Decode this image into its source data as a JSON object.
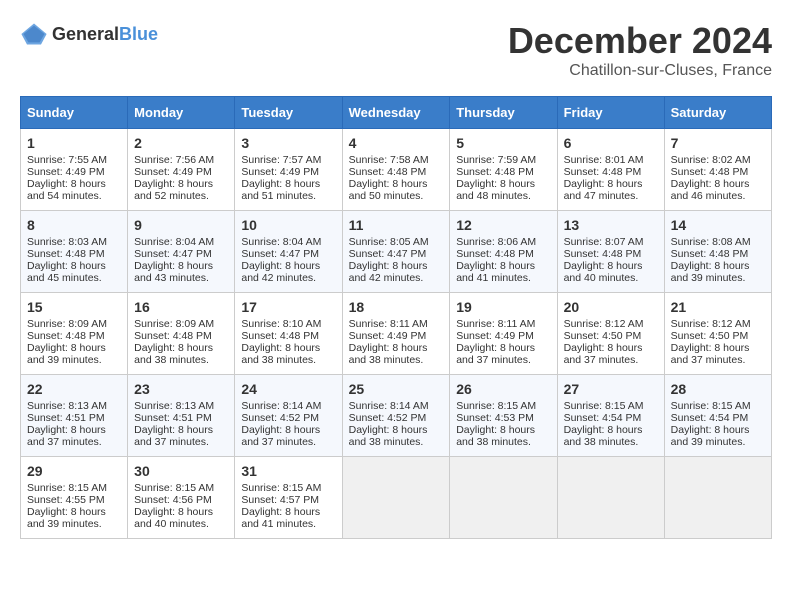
{
  "header": {
    "logo_general": "General",
    "logo_blue": "Blue",
    "title": "December 2024",
    "location": "Chatillon-sur-Cluses, France"
  },
  "calendar": {
    "days_of_week": [
      "Sunday",
      "Monday",
      "Tuesday",
      "Wednesday",
      "Thursday",
      "Friday",
      "Saturday"
    ],
    "weeks": [
      [
        {
          "day": "1",
          "sunrise": "Sunrise: 7:55 AM",
          "sunset": "Sunset: 4:49 PM",
          "daylight": "Daylight: 8 hours and 54 minutes."
        },
        {
          "day": "2",
          "sunrise": "Sunrise: 7:56 AM",
          "sunset": "Sunset: 4:49 PM",
          "daylight": "Daylight: 8 hours and 52 minutes."
        },
        {
          "day": "3",
          "sunrise": "Sunrise: 7:57 AM",
          "sunset": "Sunset: 4:49 PM",
          "daylight": "Daylight: 8 hours and 51 minutes."
        },
        {
          "day": "4",
          "sunrise": "Sunrise: 7:58 AM",
          "sunset": "Sunset: 4:48 PM",
          "daylight": "Daylight: 8 hours and 50 minutes."
        },
        {
          "day": "5",
          "sunrise": "Sunrise: 7:59 AM",
          "sunset": "Sunset: 4:48 PM",
          "daylight": "Daylight: 8 hours and 48 minutes."
        },
        {
          "day": "6",
          "sunrise": "Sunrise: 8:01 AM",
          "sunset": "Sunset: 4:48 PM",
          "daylight": "Daylight: 8 hours and 47 minutes."
        },
        {
          "day": "7",
          "sunrise": "Sunrise: 8:02 AM",
          "sunset": "Sunset: 4:48 PM",
          "daylight": "Daylight: 8 hours and 46 minutes."
        }
      ],
      [
        {
          "day": "8",
          "sunrise": "Sunrise: 8:03 AM",
          "sunset": "Sunset: 4:48 PM",
          "daylight": "Daylight: 8 hours and 45 minutes."
        },
        {
          "day": "9",
          "sunrise": "Sunrise: 8:04 AM",
          "sunset": "Sunset: 4:47 PM",
          "daylight": "Daylight: 8 hours and 43 minutes."
        },
        {
          "day": "10",
          "sunrise": "Sunrise: 8:04 AM",
          "sunset": "Sunset: 4:47 PM",
          "daylight": "Daylight: 8 hours and 42 minutes."
        },
        {
          "day": "11",
          "sunrise": "Sunrise: 8:05 AM",
          "sunset": "Sunset: 4:47 PM",
          "daylight": "Daylight: 8 hours and 42 minutes."
        },
        {
          "day": "12",
          "sunrise": "Sunrise: 8:06 AM",
          "sunset": "Sunset: 4:48 PM",
          "daylight": "Daylight: 8 hours and 41 minutes."
        },
        {
          "day": "13",
          "sunrise": "Sunrise: 8:07 AM",
          "sunset": "Sunset: 4:48 PM",
          "daylight": "Daylight: 8 hours and 40 minutes."
        },
        {
          "day": "14",
          "sunrise": "Sunrise: 8:08 AM",
          "sunset": "Sunset: 4:48 PM",
          "daylight": "Daylight: 8 hours and 39 minutes."
        }
      ],
      [
        {
          "day": "15",
          "sunrise": "Sunrise: 8:09 AM",
          "sunset": "Sunset: 4:48 PM",
          "daylight": "Daylight: 8 hours and 39 minutes."
        },
        {
          "day": "16",
          "sunrise": "Sunrise: 8:09 AM",
          "sunset": "Sunset: 4:48 PM",
          "daylight": "Daylight: 8 hours and 38 minutes."
        },
        {
          "day": "17",
          "sunrise": "Sunrise: 8:10 AM",
          "sunset": "Sunset: 4:48 PM",
          "daylight": "Daylight: 8 hours and 38 minutes."
        },
        {
          "day": "18",
          "sunrise": "Sunrise: 8:11 AM",
          "sunset": "Sunset: 4:49 PM",
          "daylight": "Daylight: 8 hours and 38 minutes."
        },
        {
          "day": "19",
          "sunrise": "Sunrise: 8:11 AM",
          "sunset": "Sunset: 4:49 PM",
          "daylight": "Daylight: 8 hours and 37 minutes."
        },
        {
          "day": "20",
          "sunrise": "Sunrise: 8:12 AM",
          "sunset": "Sunset: 4:50 PM",
          "daylight": "Daylight: 8 hours and 37 minutes."
        },
        {
          "day": "21",
          "sunrise": "Sunrise: 8:12 AM",
          "sunset": "Sunset: 4:50 PM",
          "daylight": "Daylight: 8 hours and 37 minutes."
        }
      ],
      [
        {
          "day": "22",
          "sunrise": "Sunrise: 8:13 AM",
          "sunset": "Sunset: 4:51 PM",
          "daylight": "Daylight: 8 hours and 37 minutes."
        },
        {
          "day": "23",
          "sunrise": "Sunrise: 8:13 AM",
          "sunset": "Sunset: 4:51 PM",
          "daylight": "Daylight: 8 hours and 37 minutes."
        },
        {
          "day": "24",
          "sunrise": "Sunrise: 8:14 AM",
          "sunset": "Sunset: 4:52 PM",
          "daylight": "Daylight: 8 hours and 37 minutes."
        },
        {
          "day": "25",
          "sunrise": "Sunrise: 8:14 AM",
          "sunset": "Sunset: 4:52 PM",
          "daylight": "Daylight: 8 hours and 38 minutes."
        },
        {
          "day": "26",
          "sunrise": "Sunrise: 8:15 AM",
          "sunset": "Sunset: 4:53 PM",
          "daylight": "Daylight: 8 hours and 38 minutes."
        },
        {
          "day": "27",
          "sunrise": "Sunrise: 8:15 AM",
          "sunset": "Sunset: 4:54 PM",
          "daylight": "Daylight: 8 hours and 38 minutes."
        },
        {
          "day": "28",
          "sunrise": "Sunrise: 8:15 AM",
          "sunset": "Sunset: 4:54 PM",
          "daylight": "Daylight: 8 hours and 39 minutes."
        }
      ],
      [
        {
          "day": "29",
          "sunrise": "Sunrise: 8:15 AM",
          "sunset": "Sunset: 4:55 PM",
          "daylight": "Daylight: 8 hours and 39 minutes."
        },
        {
          "day": "30",
          "sunrise": "Sunrise: 8:15 AM",
          "sunset": "Sunset: 4:56 PM",
          "daylight": "Daylight: 8 hours and 40 minutes."
        },
        {
          "day": "31",
          "sunrise": "Sunrise: 8:15 AM",
          "sunset": "Sunset: 4:57 PM",
          "daylight": "Daylight: 8 hours and 41 minutes."
        },
        null,
        null,
        null,
        null
      ]
    ]
  }
}
